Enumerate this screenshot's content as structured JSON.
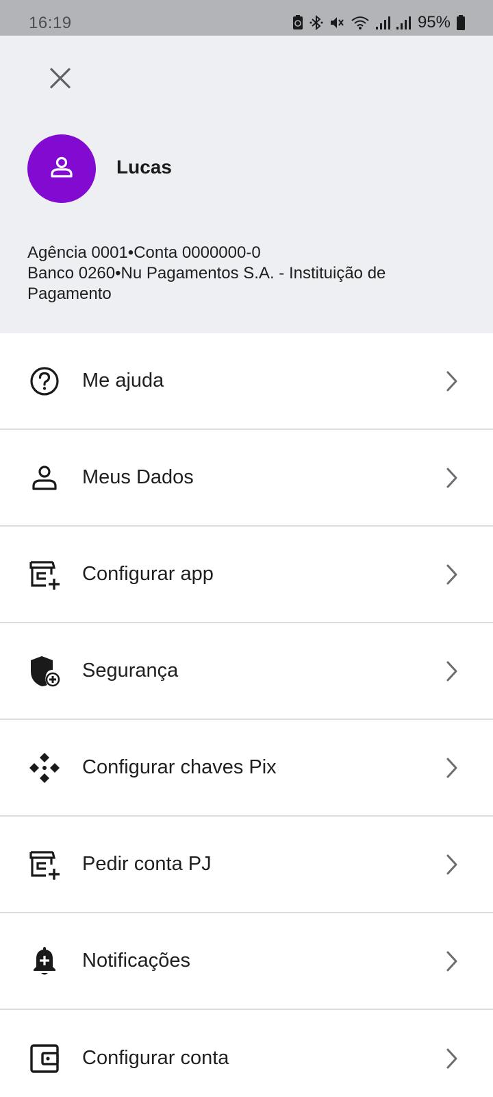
{
  "status_bar": {
    "time": "16:19",
    "battery_percent": "95%",
    "icons": [
      "battery-saver-icon",
      "bluetooth-icon",
      "mute-icon",
      "wifi-icon",
      "signal-icon",
      "signal-icon",
      "battery-icon"
    ]
  },
  "profile": {
    "close_icon": "close-icon",
    "avatar_icon": "person-icon",
    "avatar_color": "#820ad1",
    "name": "Lucas",
    "agency_line": "Agência 0001•Conta 0000000-0",
    "bank_line": "Banco 0260•Nu Pagamentos S.A. - Instituição de Pagamento"
  },
  "menu": {
    "items": [
      {
        "label": "Me ajuda",
        "icon": "help-circle-icon"
      },
      {
        "label": "Meus Dados",
        "icon": "person-icon"
      },
      {
        "label": "Configurar app",
        "icon": "store-add-icon"
      },
      {
        "label": "Segurança",
        "icon": "shield-add-icon"
      },
      {
        "label": "Configurar chaves Pix",
        "icon": "pix-icon"
      },
      {
        "label": "Pedir conta PJ",
        "icon": "store-add-icon"
      },
      {
        "label": "Notificações",
        "icon": "bell-add-icon"
      },
      {
        "label": "Configurar conta",
        "icon": "wallet-icon"
      }
    ],
    "chevron_icon": "chevron-right-icon"
  }
}
